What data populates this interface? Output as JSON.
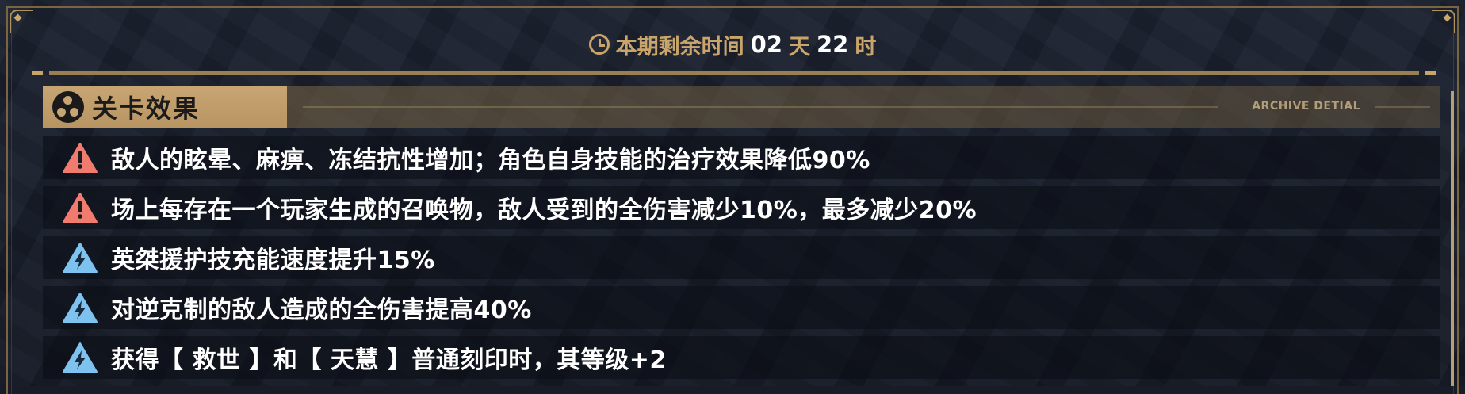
{
  "countdown": {
    "icon": "clock-icon",
    "label": "本期剩余时间",
    "days_value": "02",
    "days_unit": "天",
    "hours_value": "22",
    "hours_unit": "时"
  },
  "panel": {
    "title": "关卡效果",
    "title_icon": "radiation-icon",
    "subtitle_en": "ARCHIVE DETIAL",
    "effects": [
      {
        "icon": "warning-icon",
        "color": "#f07b6e",
        "text": "敌人的眩晕、麻痹、冻结抗性增加；角色自身技能的治疗效果降低90%"
      },
      {
        "icon": "warning-icon",
        "color": "#f07b6e",
        "text": "场上每存在一个玩家生成的召唤物，敌人受到的全伤害减少10%，最多减少20%"
      },
      {
        "icon": "lightning-icon",
        "color": "#7ec3f0",
        "text": "英桀援护技充能速度提升15%"
      },
      {
        "icon": "lightning-icon",
        "color": "#7ec3f0",
        "text": "对逆克制的敌人造成的全伤害提高40%"
      },
      {
        "icon": "lightning-icon",
        "color": "#7ec3f0",
        "text": "获得【 救世 】和【 天慧 】普通刻印时，其等级+2"
      }
    ]
  },
  "colors": {
    "gold": "#c9a56b",
    "frame": "#7a6540",
    "header_tab": "#c8a673",
    "debuff": "#f07b6e",
    "buff": "#7ec3f0"
  }
}
